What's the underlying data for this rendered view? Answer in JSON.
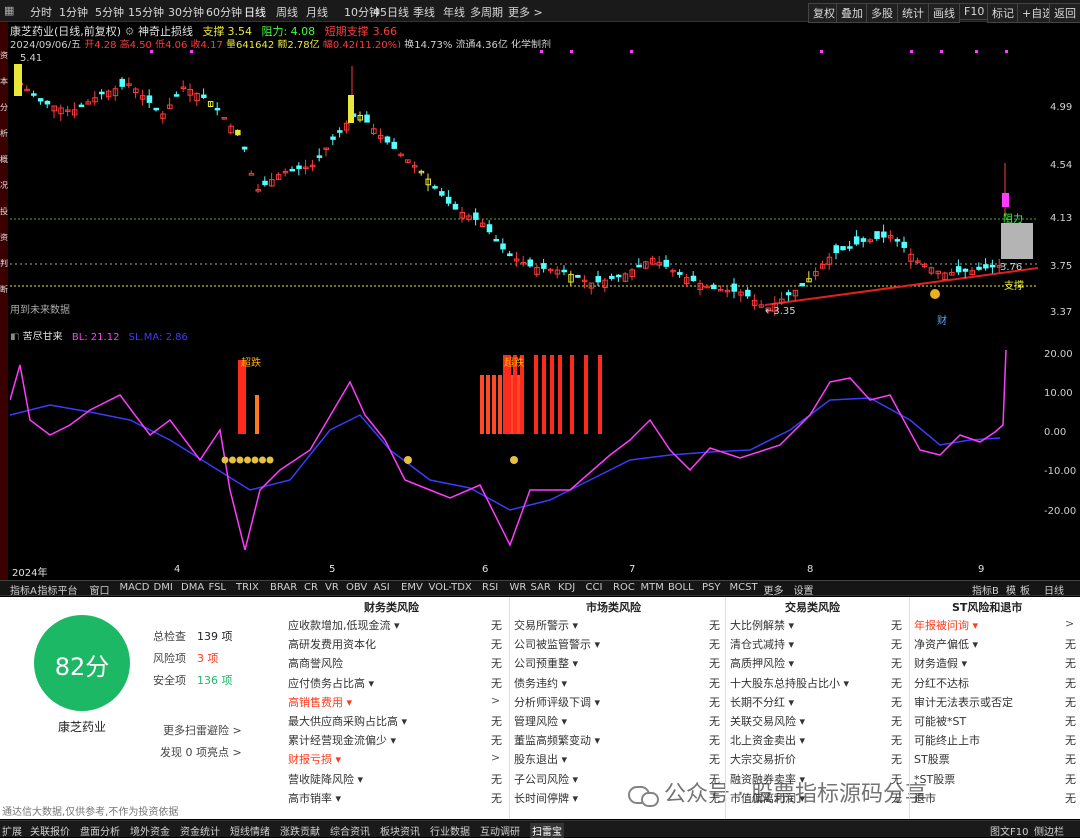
{
  "toolbar": {
    "left": [
      "分时",
      "1分钟",
      "5分钟",
      "15分钟",
      "30分钟",
      "60分钟",
      "日线",
      "周线",
      "月线",
      "10分钟",
      "45日线",
      "季线",
      "年线",
      "多周期",
      "更多 >"
    ],
    "right": [
      "复权",
      "叠加",
      "多股",
      "统计",
      "画线",
      "F10",
      "标记",
      "+自选",
      "返回"
    ]
  },
  "side_strip": [
    "资",
    "本",
    "分",
    "析",
    "概",
    "况",
    "投",
    "资",
    "判",
    "断"
  ],
  "stock": {
    "title": "康芝药业(日线,前复权)",
    "indicator": "神奇止损线",
    "support_label": "支撑",
    "support_value": "3.54",
    "resistance_label": "阻力",
    "resistance_value": "4.08",
    "short_support_label": "短期支撑",
    "short_support_value": "3.66",
    "date": "2024/09/06/五",
    "open": "开4.28",
    "high": "高4.50",
    "low": "低4.06",
    "close": "收4.17",
    "volume": "量641642",
    "amount": "额2.78亿",
    "change": "幅0.42(11.20%)",
    "turnover": "换14.73%",
    "float": "流通4.36亿",
    "sector": "化学制剂"
  },
  "price_axis": [
    "4.99",
    "4.54",
    "4.13",
    "3.75",
    "3.37"
  ],
  "price_marks": {
    "high": "5.41",
    "low": "3.35",
    "resistance_tag": "阻力",
    "support_tag": "支撑",
    "current_tag": "3.76",
    "fin_tag": "财"
  },
  "future_note": "用到未来数据",
  "x_months": [
    "2024年",
    "4",
    "5",
    "6",
    "7",
    "8",
    "9"
  ],
  "indicator_panel": {
    "name": "苦尽甘来",
    "bl": "BL: 21.12",
    "sl": "SL.MA: 2.86",
    "axis": [
      "20.00",
      "10.00",
      "0.00",
      "-10.00",
      "-20.00"
    ],
    "tag": "超跌",
    "tag2": "超跌"
  },
  "indicator_tabs": [
    "指标A",
    "指标平台",
    "窗口",
    "MACD",
    "DMI",
    "DMA",
    "FSL",
    "TRIX",
    "BRAR",
    "CR",
    "VR",
    "OBV",
    "ASI",
    "EMV",
    "VOL-TDX",
    "RSI",
    "WR",
    "SAR",
    "KDJ",
    "CCI",
    "ROC",
    "MTM",
    "BOLL",
    "PSY",
    "MCST",
    "更多",
    "设置"
  ],
  "indicator_tabs_right": [
    "指标B",
    "模",
    "板",
    "日线"
  ],
  "score": {
    "value": "82分",
    "stock_name": "康芝药业",
    "total_label": "总检查",
    "total": "139 项",
    "risk_label": "风险项",
    "risk": "3 项",
    "safe_label": "安全项",
    "safe": "136 项",
    "more": "更多扫雷避险 >",
    "found": "发现 0 项亮点 >",
    "color": "#1db866"
  },
  "risk_columns": [
    {
      "title": "财务类风险",
      "items": [
        {
          "label": "应收款增加,低现金流 ▾",
          "status": "无",
          "warn": false
        },
        {
          "label": "高研发费用资本化",
          "status": "无",
          "warn": false
        },
        {
          "label": "高商誉风险",
          "status": "无",
          "warn": false
        },
        {
          "label": "应付债务占比高 ▾",
          "status": "无",
          "warn": false
        },
        {
          "label": "高销售费用 ▾",
          "status": ">",
          "warn": true
        },
        {
          "label": "最大供应商采购占比高 ▾",
          "status": "无",
          "warn": false
        },
        {
          "label": "累计经营现金流偏少 ▾",
          "status": "无",
          "warn": false
        },
        {
          "label": "财报亏损 ▾",
          "status": ">",
          "warn": true
        },
        {
          "label": "营收陡降风险 ▾",
          "status": "无",
          "warn": false
        },
        {
          "label": "高市销率 ▾",
          "status": "无",
          "warn": false
        }
      ]
    },
    {
      "title": "市场类风险",
      "items": [
        {
          "label": "交易所警示 ▾",
          "status": "无",
          "warn": false
        },
        {
          "label": "公司被监管警示 ▾",
          "status": "无",
          "warn": false
        },
        {
          "label": "公司预重整 ▾",
          "status": "无",
          "warn": false
        },
        {
          "label": "债务违约 ▾",
          "status": "无",
          "warn": false
        },
        {
          "label": "分析师评级下调 ▾",
          "status": "无",
          "warn": false
        },
        {
          "label": "管理风险 ▾",
          "status": "无",
          "warn": false
        },
        {
          "label": "董监高频繁变动 ▾",
          "status": "无",
          "warn": false
        },
        {
          "label": "股东退出 ▾",
          "status": "无",
          "warn": false
        },
        {
          "label": "子公司风险 ▾",
          "status": "无",
          "warn": false
        },
        {
          "label": "长时间停牌 ▾",
          "status": "无",
          "warn": false
        }
      ]
    },
    {
      "title": "交易类风险",
      "items": [
        {
          "label": "大比例解禁 ▾",
          "status": "无",
          "warn": false
        },
        {
          "label": "清仓式减持 ▾",
          "status": "无",
          "warn": false
        },
        {
          "label": "高质押风险 ▾",
          "status": "无",
          "warn": false
        },
        {
          "label": "十大股东总持股占比小 ▾",
          "status": "无",
          "warn": false
        },
        {
          "label": "长期不分红 ▾",
          "status": "无",
          "warn": false
        },
        {
          "label": "关联交易风险 ▾",
          "status": "无",
          "warn": false
        },
        {
          "label": "北上资金卖出 ▾",
          "status": "无",
          "warn": false
        },
        {
          "label": "大宗交易折价",
          "status": "无",
          "warn": false
        },
        {
          "label": "融资融券卖率 ▾",
          "status": "无",
          "warn": false
        },
        {
          "label": "市值偏离利润 ▾",
          "status": "无",
          "warn": false
        }
      ]
    },
    {
      "title": "ST风险和退市",
      "items": [
        {
          "label": "年报被问询 ▾",
          "status": ">",
          "warn": true
        },
        {
          "label": "净资产偏低 ▾",
          "status": "无",
          "warn": false
        },
        {
          "label": "财务造假 ▾",
          "status": "无",
          "warn": false
        },
        {
          "label": "分红不达标",
          "status": "无",
          "warn": false
        },
        {
          "label": "审计无法表示或否定",
          "status": "无",
          "warn": false
        },
        {
          "label": "可能被*ST",
          "status": "无",
          "warn": false
        },
        {
          "label": "可能终止上市",
          "status": "无",
          "warn": false
        },
        {
          "label": "ST股票",
          "status": "无",
          "warn": false
        },
        {
          "label": "*ST股票",
          "status": "无",
          "warn": false
        },
        {
          "label": "退市",
          "status": "无",
          "warn": false
        }
      ]
    }
  ],
  "disclaimer": "通达信大数据,仅供参考,不作为投资依据",
  "watermark": "公众号 · 股票指标源码分享",
  "status_bar": [
    "扩展",
    "关联报价",
    "盘面分析",
    "境外资金",
    "资金统计",
    "短线情绪",
    "涨跌贡献",
    "综合资讯",
    "板块资讯",
    "行业数据",
    "互动调研",
    "扫雷宝"
  ],
  "status_right": [
    "图文F10",
    "侧边栏"
  ],
  "colors": {
    "up": "#ff3b3b",
    "down": "#54ffff",
    "warn": "#ff3b1e",
    "magenta": "#ff3cff",
    "blue": "#3b3bff"
  }
}
